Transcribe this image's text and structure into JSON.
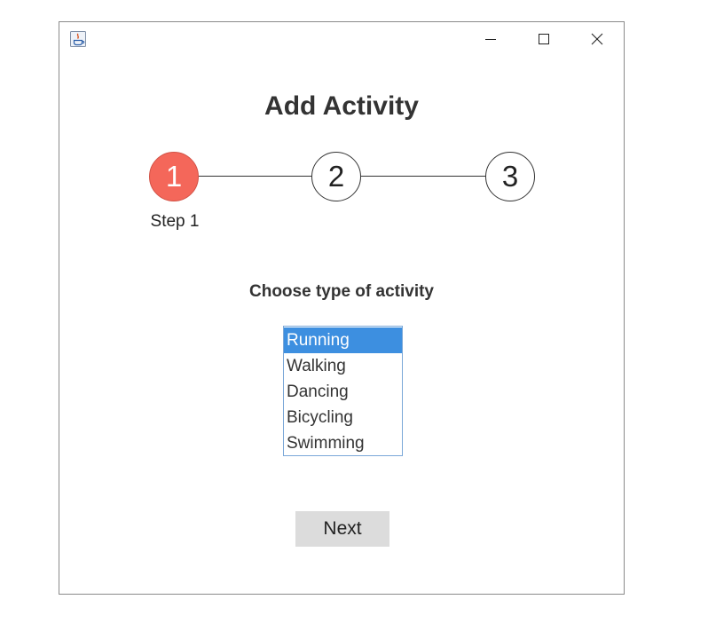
{
  "window": {
    "icon": "java-app-icon",
    "controls": {
      "minimize_icon": "minimize-icon",
      "maximize_icon": "maximize-icon",
      "close_icon": "close-icon"
    }
  },
  "header": {
    "title": "Add Activity"
  },
  "stepper": {
    "steps": [
      {
        "number": "1",
        "label": "Step 1",
        "active": true
      },
      {
        "number": "2",
        "label": "",
        "active": false
      },
      {
        "number": "3",
        "label": "",
        "active": false
      }
    ],
    "active_color": "#f4675a"
  },
  "form": {
    "prompt": "Choose type of activity",
    "activity_options": [
      "Running",
      "Walking",
      "Dancing",
      "Bicycling",
      "Swimming"
    ],
    "selected_option": "Running",
    "selection_color": "#3d8fe0"
  },
  "footer": {
    "next_label": "Next"
  }
}
